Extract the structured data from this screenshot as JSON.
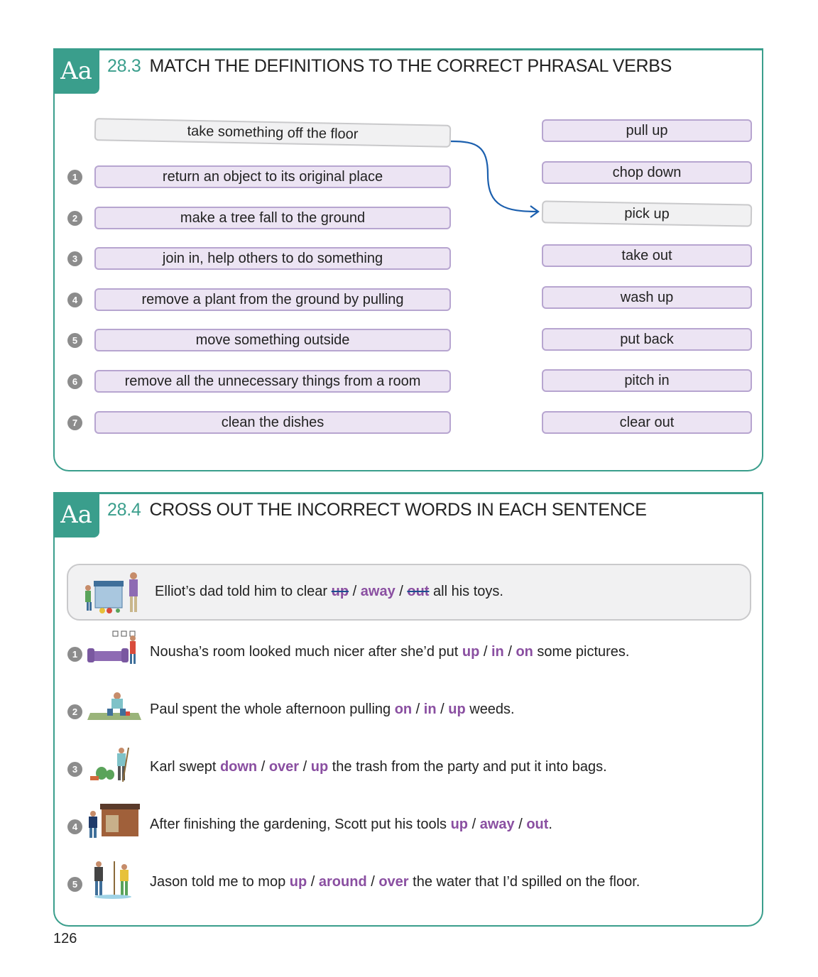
{
  "section1": {
    "tab": "Aa",
    "number": "28.3",
    "title": "MATCH THE DEFINITIONS TO THE CORRECT PHRASAL VERBS",
    "example_definition": "take something off the floor",
    "definitions": [
      {
        "num": "1",
        "text": "return an object to its original place"
      },
      {
        "num": "2",
        "text": "make a tree fall to the ground"
      },
      {
        "num": "3",
        "text": "join in, help others to do something"
      },
      {
        "num": "4",
        "text": "remove a plant from the ground by pulling"
      },
      {
        "num": "5",
        "text": "move something outside"
      },
      {
        "num": "6",
        "text": "remove all the unnecessary things from a room"
      },
      {
        "num": "7",
        "text": "clean the dishes"
      }
    ],
    "verbs": [
      "pull up",
      "chop down",
      "pick up",
      "take out",
      "wash up",
      "put back",
      "pitch in",
      "clear out"
    ],
    "example_verb_index": 2,
    "arrow_color": "#1b5fae"
  },
  "section2": {
    "tab": "Aa",
    "number": "28.4",
    "title": "CROSS OUT THE INCORRECT WORDS IN EACH SENTENCE",
    "example": {
      "before": "Elliot’s dad told him to clear",
      "options": [
        "up",
        "away",
        "out"
      ],
      "crossed": [
        0,
        2
      ],
      "after": "all his toys."
    },
    "sentences": [
      {
        "num": "1",
        "before": "Nousha’s room looked much nicer after she’d put",
        "options": [
          "up",
          "in",
          "on"
        ],
        "after": "some pictures."
      },
      {
        "num": "2",
        "before": "Paul spent the whole afternoon pulling",
        "options": [
          "on",
          "in",
          "up"
        ],
        "after": "weeds."
      },
      {
        "num": "3",
        "before": "Karl swept",
        "options": [
          "down",
          "over",
          "up"
        ],
        "after": "the trash from the party and put it into bags."
      },
      {
        "num": "4",
        "before": "After finishing the gardening, Scott put his tools",
        "options": [
          "up",
          "away",
          "out"
        ],
        "after": "."
      },
      {
        "num": "5",
        "before": "Jason told me to mop",
        "options": [
          "up",
          "around",
          "over"
        ],
        "after": "the water that I’d spilled on the floor."
      }
    ],
    "option_color": "#8a4fa1",
    "accent_color": "#3a9e8c"
  },
  "page_number": "126"
}
